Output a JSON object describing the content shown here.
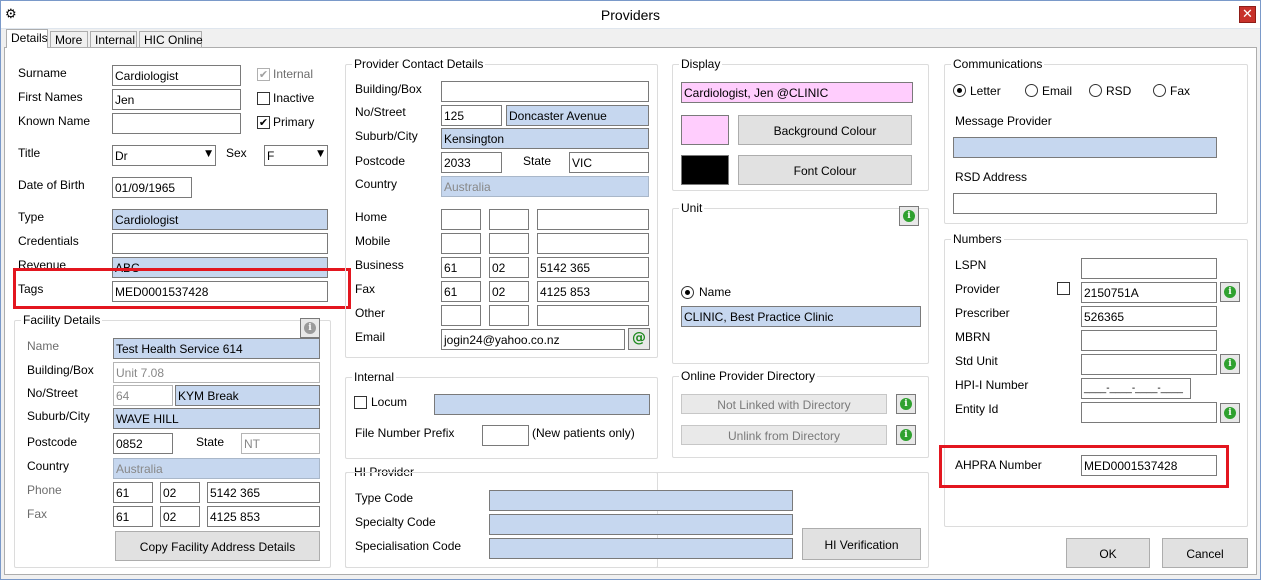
{
  "window": {
    "title": "Providers"
  },
  "tabs": [
    "Details",
    "More",
    "Internal",
    "HIC Online"
  ],
  "personal": {
    "surname_label": "Surname",
    "surname": "Cardiologist",
    "first_names_label": "First Names",
    "first_names": "Jen",
    "known_name_label": "Known Name",
    "known_name": "",
    "title_label": "Title",
    "title": "Dr",
    "sex_label": "Sex",
    "sex": "F",
    "dob_label": "Date of Birth",
    "dob": "01/09/1965",
    "type_label": "Type",
    "type": "Cardiologist",
    "credentials_label": "Credentials",
    "credentials": "",
    "revenue_label": "Revenue",
    "revenue": "ABC",
    "tags_label": "Tags",
    "tags": "MED0001537428",
    "internal_label": "Internal",
    "internal_checked": true,
    "inactive_label": "Inactive",
    "inactive_checked": false,
    "primary_label": "Primary",
    "primary_checked": true
  },
  "facility": {
    "title": "Facility Details",
    "name_label": "Name",
    "name": "Test Health Service 614",
    "building_label": "Building/Box",
    "building": "Unit 7.08",
    "street_label": "No/Street",
    "street_no": "64",
    "street": "KYM Break",
    "suburb_label": "Suburb/City",
    "suburb": "WAVE HILL",
    "postcode_label": "Postcode",
    "postcode": "0852",
    "state_label": "State",
    "state": "NT",
    "country_label": "Country",
    "country": "Australia",
    "phone_label": "Phone",
    "phone": [
      "61",
      "02",
      "5142 365"
    ],
    "fax_label": "Fax",
    "fax": [
      "61",
      "02",
      "4125 853"
    ],
    "copy_button": "Copy Facility Address Details"
  },
  "contact": {
    "title": "Provider Contact Details",
    "building_label": "Building/Box",
    "building": "",
    "street_label": "No/Street",
    "street_no": "125",
    "street": "Doncaster Avenue",
    "suburb_label": "Suburb/City",
    "suburb": "Kensington",
    "postcode_label": "Postcode",
    "postcode": "2033",
    "state_label": "State",
    "state": "VIC",
    "country_label": "Country",
    "country": "Australia",
    "home_label": "Home",
    "home": [
      "",
      "",
      ""
    ],
    "mobile_label": "Mobile",
    "mobile": [
      "",
      "",
      ""
    ],
    "business_label": "Business",
    "business": [
      "61",
      "02",
      "5142 365"
    ],
    "fax_label": "Fax",
    "fax": [
      "61",
      "02",
      "4125 853"
    ],
    "other_label": "Other",
    "other": [
      "",
      "",
      ""
    ],
    "email_label": "Email",
    "email": "jogin24@yahoo.co.nz",
    "email_icon": "@"
  },
  "internal": {
    "title": "Internal",
    "locum_label": "Locum",
    "locum_checked": false,
    "locum_value": "",
    "file_prefix_label": "File Number Prefix",
    "file_prefix": "",
    "file_prefix_note": "(New patients only)"
  },
  "hi_provider": {
    "title": "HI Provider",
    "type_code_label": "Type Code",
    "type_code": "",
    "specialty_code_label": "Specialty Code",
    "specialty_code": "",
    "specialisation_code_label": "Specialisation Code",
    "specialisation_code": "",
    "verify_button": "HI Verification"
  },
  "display": {
    "title": "Display",
    "display_name": "Cardiologist, Jen @CLINIC",
    "background_button": "Background Colour",
    "font_button": "Font Colour",
    "background_color": "#ffcdfd",
    "font_color": "#000000"
  },
  "unit": {
    "title": "Unit",
    "name_label": "Name",
    "name_selected": true,
    "name_value": "CLINIC, Best Practice Clinic"
  },
  "online_directory": {
    "title": "Online Provider Directory",
    "not_linked_button": "Not Linked with Directory",
    "unlink_button": "Unlink from Directory"
  },
  "communications": {
    "title": "Communications",
    "options": [
      "Letter",
      "Email",
      "RSD",
      "Fax"
    ],
    "selected": "Letter",
    "message_provider_label": "Message Provider",
    "message_provider": "",
    "rsd_address_label": "RSD Address",
    "rsd_address": ""
  },
  "numbers": {
    "title": "Numbers",
    "lspn_label": "LSPN",
    "lspn": "",
    "provider_label": "Provider",
    "provider": "2150751A",
    "provider_checked": false,
    "prescriber_label": "Prescriber",
    "prescriber": "526365",
    "mbrn_label": "MBRN",
    "mbrn": "",
    "std_unit_label": "Std Unit",
    "std_unit": "",
    "hpii_label": "HPI-I Number",
    "hpii": "____-____-____-____",
    "entity_label": "Entity Id",
    "entity": "",
    "ahpra_label": "AHPRA Number",
    "ahpra": "MED0001537428"
  },
  "footer": {
    "ok": "OK",
    "cancel": "Cancel"
  },
  "highlight_color": "#e3161f"
}
